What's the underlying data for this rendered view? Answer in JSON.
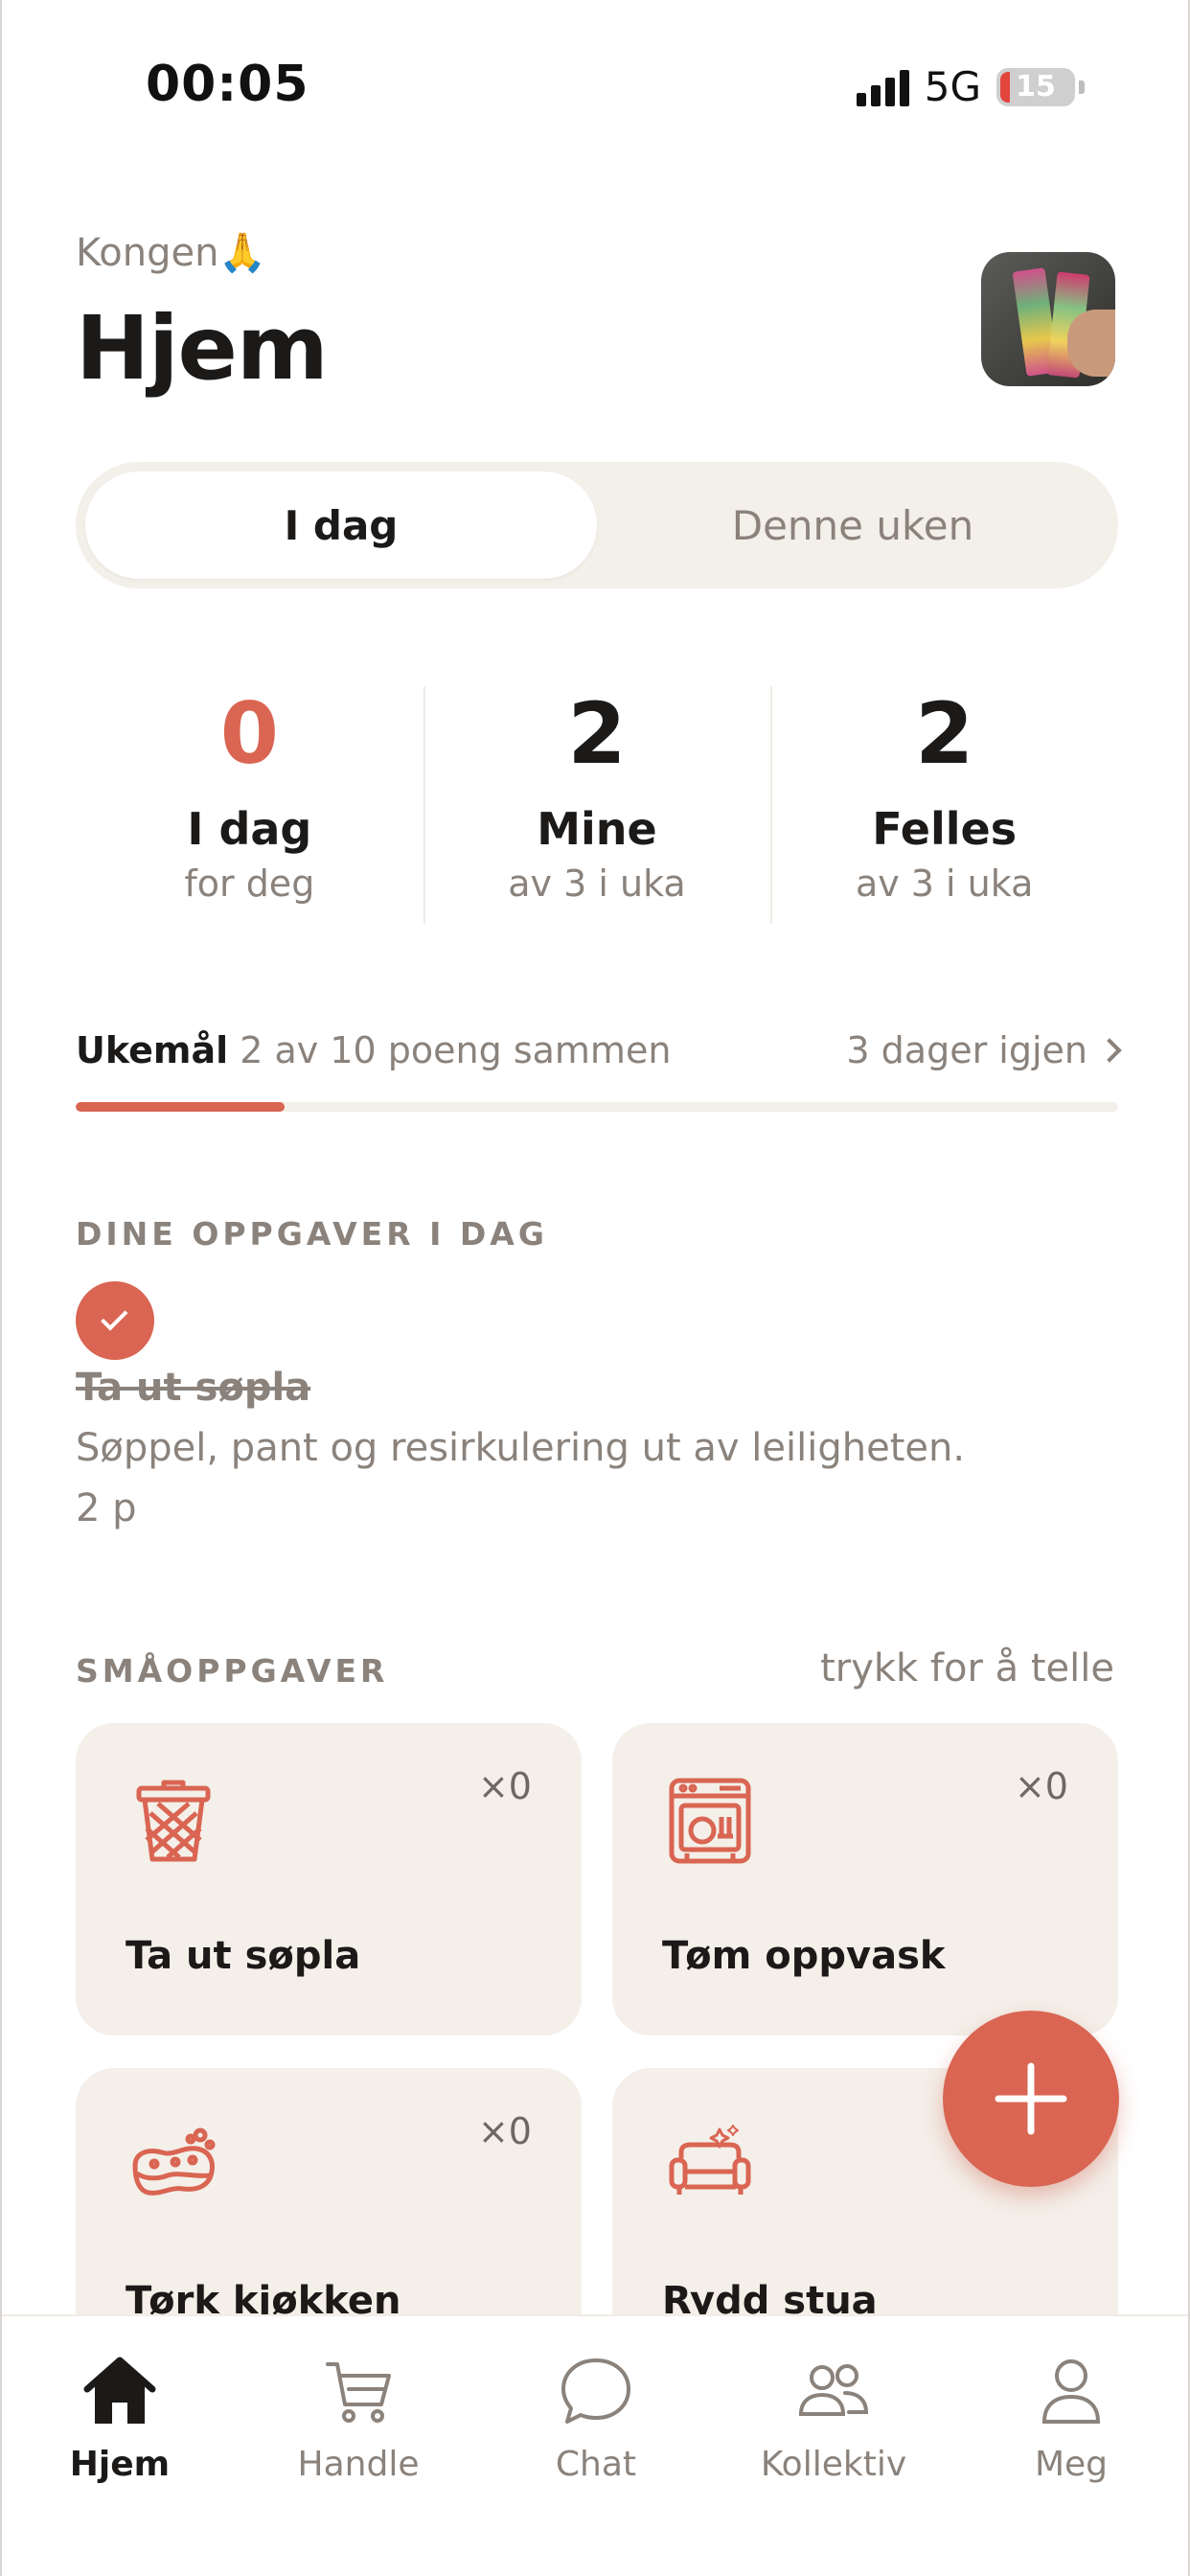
{
  "status_bar": {
    "time": "00:05",
    "network": "5G",
    "battery": "15"
  },
  "header": {
    "eyebrow": "Kongen🙏",
    "title": "Hjem"
  },
  "segmented": {
    "today": "I dag",
    "week": "Denne uken"
  },
  "stats": [
    {
      "value": "0",
      "label": "I dag",
      "sub": "for deg"
    },
    {
      "value": "2",
      "label": "Mine",
      "sub": "av 3 i uka"
    },
    {
      "value": "2",
      "label": "Felles",
      "sub": "av 3 i uka"
    }
  ],
  "goal": {
    "label": "Ukemål",
    "text": "2 av 10 poeng sammen",
    "remaining": "3 dager igjen",
    "progress_fraction": 0.2
  },
  "tasks_section": {
    "heading": "DINE OPPGAVER I DAG",
    "task": {
      "title": "Ta ut søpla",
      "description": "Søppel, pant og resirkulering ut av leiligheten.",
      "points": "2 p"
    }
  },
  "small_tasks": {
    "heading": "SMÅOPPGAVER",
    "hint": "trykk for å telle",
    "cards": [
      {
        "title": "Ta ut søpla",
        "count": "×0",
        "icon": "trash-bin-icon"
      },
      {
        "title": "Tøm oppvask",
        "count": "×0",
        "icon": "dishwasher-icon"
      },
      {
        "title": "Tørk kjøkken",
        "count": "×0",
        "icon": "sponge-icon"
      },
      {
        "title": "Rydd stua",
        "count": "",
        "icon": "sofa-icon"
      }
    ]
  },
  "tabbar": {
    "items": [
      {
        "label": "Hjem",
        "icon": "home-icon"
      },
      {
        "label": "Handle",
        "icon": "cart-icon"
      },
      {
        "label": "Chat",
        "icon": "chat-bubble-icon"
      },
      {
        "label": "Kollektiv",
        "icon": "people-icon"
      },
      {
        "label": "Meg",
        "icon": "user-icon"
      }
    ]
  },
  "colors": {
    "accent": "#d96552",
    "card_bg": "#f4efe9",
    "muted_text": "#8a827b",
    "primary_text": "#1c1a19"
  }
}
